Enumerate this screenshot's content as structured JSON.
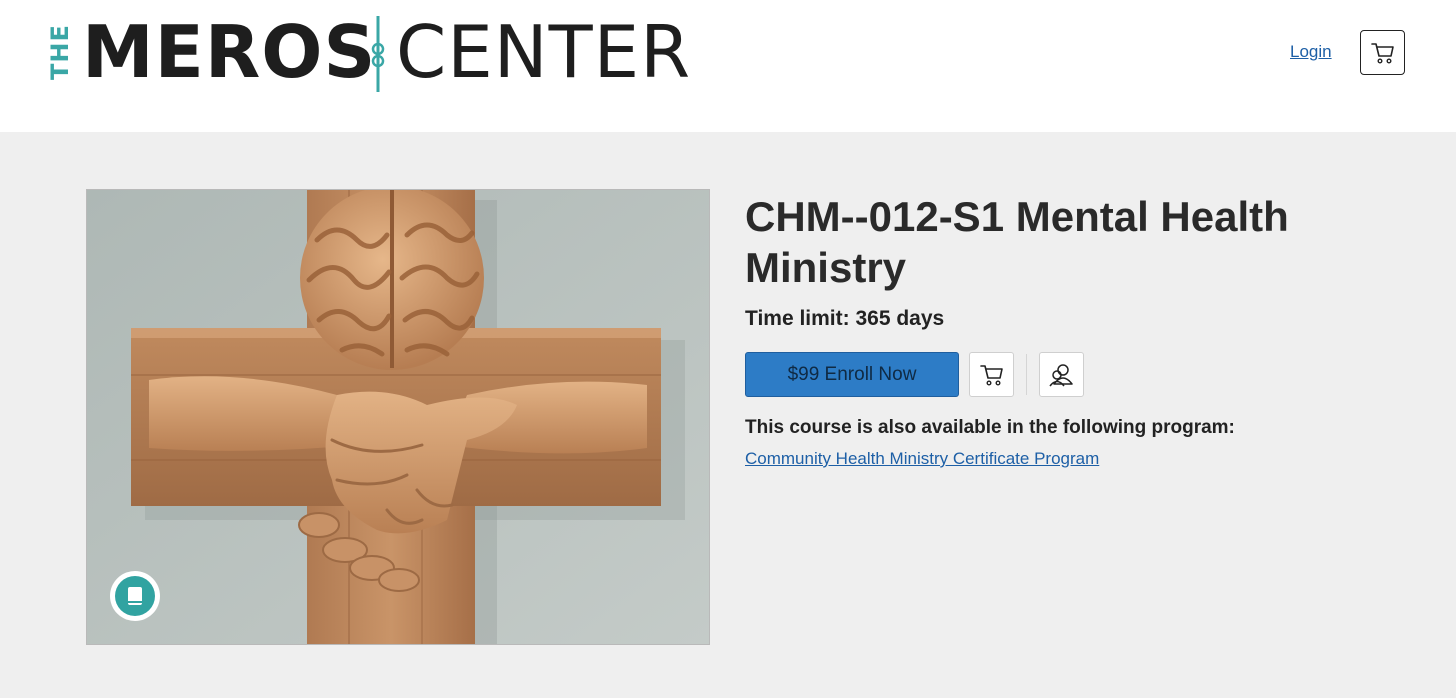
{
  "header": {
    "logo": {
      "the": "THE",
      "word1": "MEROS",
      "word2": "CENTER"
    },
    "login_label": "Login",
    "cart_icon": "cart-icon",
    "brand_teal": "#3aa7a6"
  },
  "course": {
    "image_alt": "Wooden cross with a carved brain at the top and two hands shaking across the arms",
    "badge_icon": "book-icon",
    "title": "CHM--012-S1 Mental Health Ministry",
    "time_limit": "Time limit: 365 days",
    "enroll_label": "$99 Enroll Now",
    "add_to_cart_icon": "cart-icon",
    "gift_icon": "users-icon",
    "program_note": "This course is also available in the following program:",
    "program_link": "Community Health Ministry Certificate Program",
    "accent": "#2d7cc6"
  }
}
